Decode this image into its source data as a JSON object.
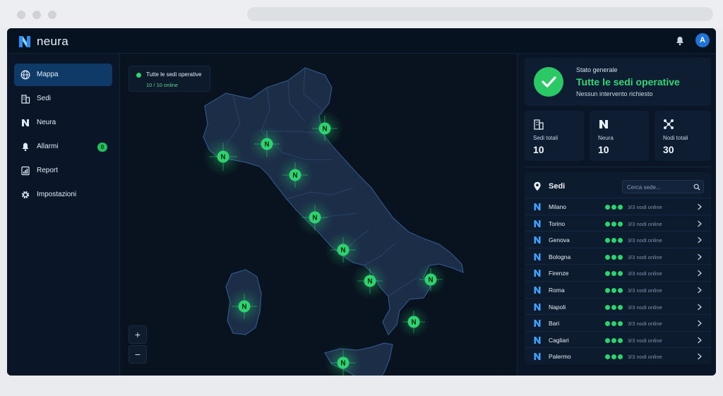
{
  "app": {
    "name": "neura",
    "avatar_initial": "A"
  },
  "colors": {
    "accent": "#2dd36f",
    "brand": "#1f74d6",
    "active_nav": "#0f3a67",
    "background": "#07121f"
  },
  "sidebar": {
    "items": [
      {
        "label": "Mappa",
        "icon": "globe-icon",
        "active": true
      },
      {
        "label": "Sedi",
        "icon": "building-icon"
      },
      {
        "label": "Neura",
        "icon": "neura-logo-icon"
      },
      {
        "label": "Allarmi",
        "icon": "bell-icon",
        "badge": "0"
      },
      {
        "label": "Report",
        "icon": "report-icon"
      },
      {
        "label": "Impostazioni",
        "icon": "gear-icon"
      }
    ]
  },
  "map": {
    "status_title": "Tutte le sedi operative",
    "status_sub": "10 / 10 online",
    "zoom_in": "+",
    "zoom_out": "−"
  },
  "general": {
    "label": "Stato generale",
    "title": "Tutte le sedi operative",
    "subtitle": "Nessun intervento richiesto"
  },
  "stats": [
    {
      "label": "Sedi totali",
      "value": "10",
      "icon": "building-icon"
    },
    {
      "label": "Neura",
      "value": "10",
      "icon": "neura-logo-icon"
    },
    {
      "label": "Nodi totali",
      "value": "30",
      "icon": "nodes-icon"
    }
  ],
  "sedi": {
    "title": "Sedi",
    "search_placeholder": "Cerca sede...",
    "rows": [
      {
        "name": "Milano",
        "status": "3/3 nodi online"
      },
      {
        "name": "Torino",
        "status": "3/3 nodi online"
      },
      {
        "name": "Genova",
        "status": "3/3 nodi online"
      },
      {
        "name": "Bologna",
        "status": "3/3 nodi online"
      },
      {
        "name": "Firenze",
        "status": "3/3 nodi online"
      },
      {
        "name": "Roma",
        "status": "3/3 nodi online"
      },
      {
        "name": "Napoli",
        "status": "3/3 nodi online"
      },
      {
        "name": "Bari",
        "status": "3/3 nodi online"
      },
      {
        "name": "Cagliari",
        "status": "3/3 nodi online"
      },
      {
        "name": "Palermo",
        "status": "3/3 nodi online"
      }
    ]
  }
}
